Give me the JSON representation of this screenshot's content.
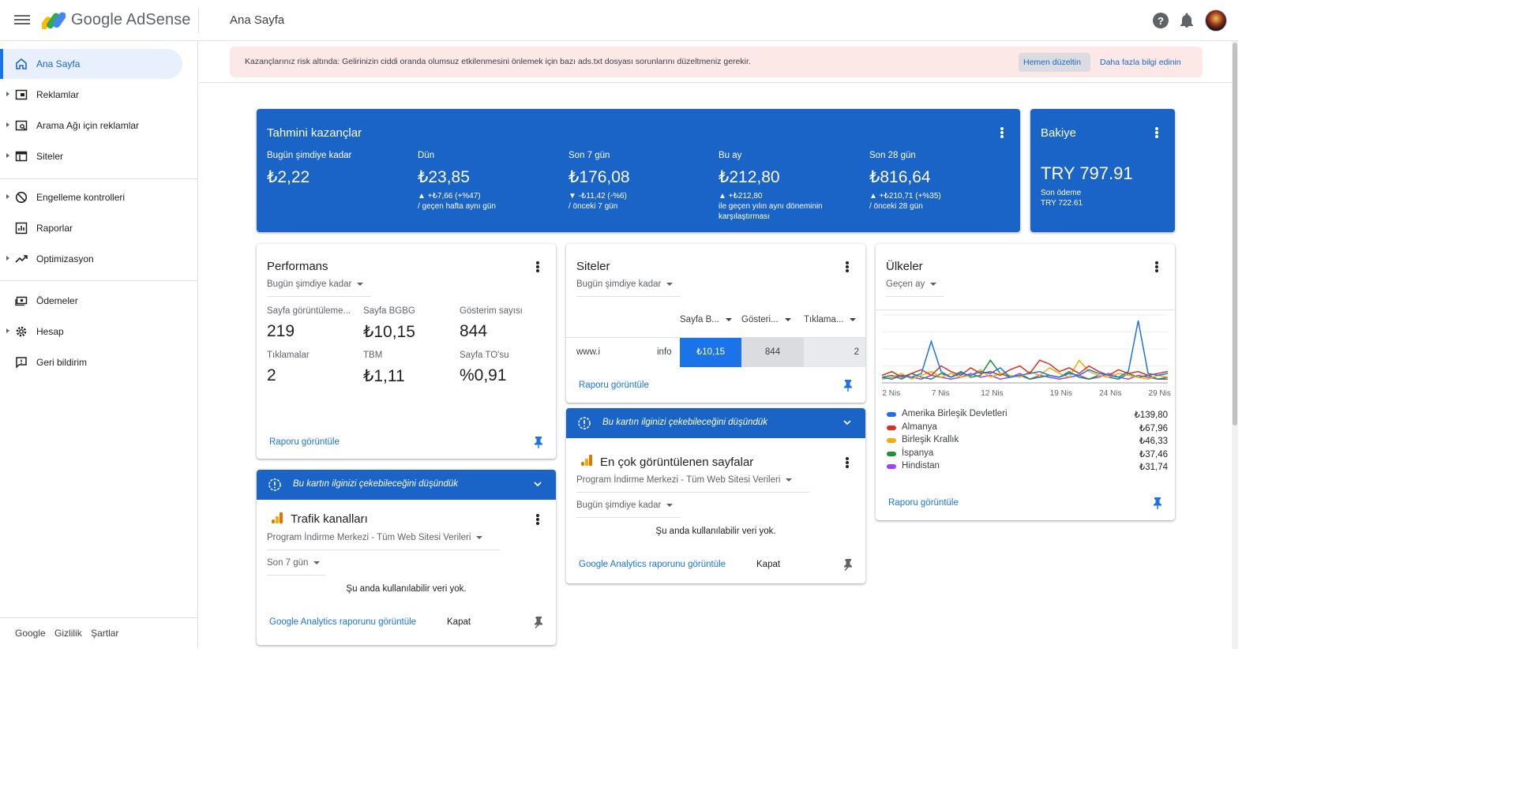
{
  "app": {
    "brand": "Google AdSense",
    "page_title": "Ana Sayfa"
  },
  "sidebar": {
    "items": [
      {
        "label": "Ana Sayfa",
        "icon": "home-icon"
      },
      {
        "label": "Reklamlar",
        "icon": "ads-icon"
      },
      {
        "label": "Arama Ağı için reklamlar",
        "icon": "search-ads-icon"
      },
      {
        "label": "Siteler",
        "icon": "sites-icon"
      },
      {
        "label": "Engelleme kontrolleri",
        "icon": "block-icon"
      },
      {
        "label": "Raporlar",
        "icon": "reports-icon"
      },
      {
        "label": "Optimizasyon",
        "icon": "trending-icon"
      },
      {
        "label": "Ödemeler",
        "icon": "payments-icon"
      },
      {
        "label": "Hesap",
        "icon": "gear-icon"
      },
      {
        "label": "Geri bildirim",
        "icon": "feedback-icon"
      }
    ],
    "footer": [
      "Google",
      "Gizlilik",
      "Şartlar"
    ]
  },
  "alert": {
    "text": "Kazançlarınız risk altında: Gelirinizin ciddi oranda olumsuz etkilenmesini önlemek için bazı ads.txt dosyası sorunlarını düzeltmeniz gerekir.",
    "fix_label": "Hemen düzeltin",
    "more_label": "Daha fazla bilgi edinin"
  },
  "earnings": {
    "title": "Tahmini kazançlar",
    "stats": [
      {
        "label": "Bugün şimdiye kadar",
        "value": "₺2,22",
        "delta": "",
        "sub": ""
      },
      {
        "label": "Dün",
        "value": "₺23,85",
        "delta": "▲ +₺7,66 (+%47)",
        "sub": "/ geçen hafta aynı gün"
      },
      {
        "label": "Son 7 gün",
        "value": "₺176,08",
        "delta": "▼ -₺11,42 (-%6)",
        "sub": "/ önceki 7 gün"
      },
      {
        "label": "Bu ay",
        "value": "₺212,80",
        "delta": "▲ +₺212,80",
        "sub": "ile geçen yılın aynı döneminin karşılaştırması"
      },
      {
        "label": "Son 28 gün",
        "value": "₺816,64",
        "delta": "▲ +₺210,71 (+%35)",
        "sub": "/ önceki 28 gün"
      }
    ]
  },
  "balance": {
    "title": "Bakiye",
    "value": "TRY 797.91",
    "last_label": "Son ödeme",
    "last_value": "TRY 722.61"
  },
  "performance": {
    "title": "Performans",
    "period": "Bugün şimdiye kadar",
    "metrics": [
      {
        "label": "Sayfa görüntüleme...",
        "value": "219"
      },
      {
        "label": "Sayfa BGBG",
        "value": "₺10,15"
      },
      {
        "label": "Gösterim sayısı",
        "value": "844"
      },
      {
        "label": "Tıklamalar",
        "value": "2"
      },
      {
        "label": "TBM",
        "value": "₺1,11"
      },
      {
        "label": "Sayfa TO'su",
        "value": "%0,91"
      }
    ],
    "report_link": "Raporu görüntüle"
  },
  "traffic": {
    "banner": "Bu kartın ilginizi çekebileceğini düşündük",
    "title": "Trafik kanalları",
    "property": "Program İndirme Merkezi - Tüm Web Sitesi Verileri",
    "period": "Son 7 gün",
    "empty": "Şu anda kullanılabilir veri yok.",
    "ga_link": "Google Analytics raporunu görüntüle",
    "close": "Kapat"
  },
  "sites": {
    "title": "Siteler",
    "period": "Bugün şimdiye kadar",
    "columns": [
      "Sayfa B...",
      "Gösteri...",
      "Tıklama..."
    ],
    "row": {
      "site_prefix": "www.i",
      "site_suffix": "info",
      "rpm": "₺10,15",
      "impressions": "844",
      "clicks": "2"
    },
    "report_link": "Raporu görüntüle"
  },
  "top_pages": {
    "banner": "Bu kartın ilginizi çekebileceğini düşündük",
    "title": "En çok görüntülenen sayfalar",
    "property": "Program İndirme Merkezi - Tüm Web Sitesi Verileri",
    "period": "Bugün şimdiye kadar",
    "empty": "Şu anda kullanılabilir veri yok.",
    "ga_link": "Google Analytics raporunu görüntüle",
    "close": "Kapat"
  },
  "countries": {
    "title": "Ülkeler",
    "period": "Geçen ay",
    "report_link": "Raporu görüntüle",
    "legend": [
      {
        "name": "Amerika Birleşik Devletleri",
        "value": "₺139,80",
        "color": "#1a73e8"
      },
      {
        "name": "Almanya",
        "value": "₺67,96",
        "color": "#d93025"
      },
      {
        "name": "Birleşik Krallık",
        "value": "₺46,33",
        "color": "#f9ab00"
      },
      {
        "name": "İspanya",
        "value": "₺37,46",
        "color": "#1e8e3e"
      },
      {
        "name": "Hindistan",
        "value": "₺31,74",
        "color": "#a142f4"
      }
    ]
  },
  "chart_data": {
    "type": "line",
    "x_tick_labels": [
      "2 Nis",
      "7 Nis",
      "12 Nis",
      "19 Nis",
      "24 Nis",
      "29 Nis"
    ],
    "x": [
      1,
      2,
      3,
      4,
      5,
      6,
      7,
      8,
      9,
      10,
      11,
      12,
      13,
      14,
      15,
      16,
      17,
      18,
      19,
      20,
      21,
      22,
      23,
      24,
      25,
      26,
      27,
      28,
      29,
      30
    ],
    "series": [
      {
        "name": "Amerika Birleşik Devletleri",
        "color": "#1a73e8",
        "values": [
          3,
          2,
          4,
          3,
          5,
          22,
          6,
          3,
          5,
          4,
          6,
          5,
          8,
          3,
          4,
          5,
          6,
          4,
          3,
          5,
          4,
          7,
          5,
          4,
          3,
          6,
          33,
          5,
          4,
          5
        ]
      },
      {
        "name": "Almanya",
        "color": "#d93025",
        "values": [
          4,
          6,
          3,
          5,
          7,
          4,
          9,
          6,
          4,
          8,
          5,
          6,
          4,
          7,
          9,
          5,
          12,
          10,
          6,
          8,
          5,
          9,
          6,
          4,
          7,
          5,
          6,
          4,
          5,
          6
        ]
      },
      {
        "name": "Birleşik Krallık",
        "color": "#f9ab00",
        "values": [
          2,
          3,
          5,
          2,
          4,
          6,
          3,
          5,
          3,
          4,
          7,
          3,
          5,
          4,
          3,
          6,
          4,
          8,
          5,
          3,
          12,
          6,
          4,
          3,
          5,
          4,
          3,
          2,
          4,
          3
        ]
      },
      {
        "name": "İspanya",
        "color": "#1e8e3e",
        "values": [
          3,
          4,
          2,
          5,
          3,
          2,
          5,
          3,
          6,
          3,
          4,
          12,
          5,
          3,
          4,
          2,
          3,
          4,
          3,
          6,
          3,
          2,
          4,
          3,
          2,
          5,
          3,
          4,
          2,
          3
        ]
      },
      {
        "name": "Hindistan",
        "color": "#a142f4",
        "values": [
          2,
          3,
          4,
          3,
          2,
          4,
          3,
          2,
          3,
          5,
          3,
          4,
          2,
          3,
          5,
          2,
          4,
          3,
          2,
          3,
          4,
          2,
          3,
          5,
          3,
          2,
          4,
          3,
          2,
          2
        ]
      }
    ],
    "grid": true,
    "legend": "below"
  }
}
